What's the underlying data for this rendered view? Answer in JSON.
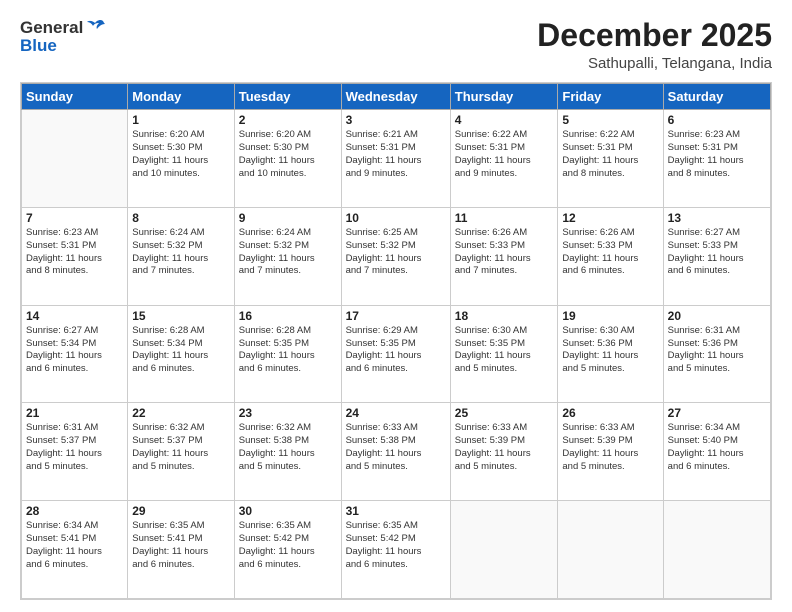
{
  "logo": {
    "general": "General",
    "blue": "Blue"
  },
  "title": "December 2025",
  "location": "Sathupalli, Telangana, India",
  "weekdays": [
    "Sunday",
    "Monday",
    "Tuesday",
    "Wednesday",
    "Thursday",
    "Friday",
    "Saturday"
  ],
  "weeks": [
    [
      {
        "day": "",
        "info": ""
      },
      {
        "day": "1",
        "info": "Sunrise: 6:20 AM\nSunset: 5:30 PM\nDaylight: 11 hours\nand 10 minutes."
      },
      {
        "day": "2",
        "info": "Sunrise: 6:20 AM\nSunset: 5:30 PM\nDaylight: 11 hours\nand 10 minutes."
      },
      {
        "day": "3",
        "info": "Sunrise: 6:21 AM\nSunset: 5:31 PM\nDaylight: 11 hours\nand 9 minutes."
      },
      {
        "day": "4",
        "info": "Sunrise: 6:22 AM\nSunset: 5:31 PM\nDaylight: 11 hours\nand 9 minutes."
      },
      {
        "day": "5",
        "info": "Sunrise: 6:22 AM\nSunset: 5:31 PM\nDaylight: 11 hours\nand 8 minutes."
      },
      {
        "day": "6",
        "info": "Sunrise: 6:23 AM\nSunset: 5:31 PM\nDaylight: 11 hours\nand 8 minutes."
      }
    ],
    [
      {
        "day": "7",
        "info": "Sunrise: 6:23 AM\nSunset: 5:31 PM\nDaylight: 11 hours\nand 8 minutes."
      },
      {
        "day": "8",
        "info": "Sunrise: 6:24 AM\nSunset: 5:32 PM\nDaylight: 11 hours\nand 7 minutes."
      },
      {
        "day": "9",
        "info": "Sunrise: 6:24 AM\nSunset: 5:32 PM\nDaylight: 11 hours\nand 7 minutes."
      },
      {
        "day": "10",
        "info": "Sunrise: 6:25 AM\nSunset: 5:32 PM\nDaylight: 11 hours\nand 7 minutes."
      },
      {
        "day": "11",
        "info": "Sunrise: 6:26 AM\nSunset: 5:33 PM\nDaylight: 11 hours\nand 7 minutes."
      },
      {
        "day": "12",
        "info": "Sunrise: 6:26 AM\nSunset: 5:33 PM\nDaylight: 11 hours\nand 6 minutes."
      },
      {
        "day": "13",
        "info": "Sunrise: 6:27 AM\nSunset: 5:33 PM\nDaylight: 11 hours\nand 6 minutes."
      }
    ],
    [
      {
        "day": "14",
        "info": "Sunrise: 6:27 AM\nSunset: 5:34 PM\nDaylight: 11 hours\nand 6 minutes."
      },
      {
        "day": "15",
        "info": "Sunrise: 6:28 AM\nSunset: 5:34 PM\nDaylight: 11 hours\nand 6 minutes."
      },
      {
        "day": "16",
        "info": "Sunrise: 6:28 AM\nSunset: 5:35 PM\nDaylight: 11 hours\nand 6 minutes."
      },
      {
        "day": "17",
        "info": "Sunrise: 6:29 AM\nSunset: 5:35 PM\nDaylight: 11 hours\nand 6 minutes."
      },
      {
        "day": "18",
        "info": "Sunrise: 6:30 AM\nSunset: 5:35 PM\nDaylight: 11 hours\nand 5 minutes."
      },
      {
        "day": "19",
        "info": "Sunrise: 6:30 AM\nSunset: 5:36 PM\nDaylight: 11 hours\nand 5 minutes."
      },
      {
        "day": "20",
        "info": "Sunrise: 6:31 AM\nSunset: 5:36 PM\nDaylight: 11 hours\nand 5 minutes."
      }
    ],
    [
      {
        "day": "21",
        "info": "Sunrise: 6:31 AM\nSunset: 5:37 PM\nDaylight: 11 hours\nand 5 minutes."
      },
      {
        "day": "22",
        "info": "Sunrise: 6:32 AM\nSunset: 5:37 PM\nDaylight: 11 hours\nand 5 minutes."
      },
      {
        "day": "23",
        "info": "Sunrise: 6:32 AM\nSunset: 5:38 PM\nDaylight: 11 hours\nand 5 minutes."
      },
      {
        "day": "24",
        "info": "Sunrise: 6:33 AM\nSunset: 5:38 PM\nDaylight: 11 hours\nand 5 minutes."
      },
      {
        "day": "25",
        "info": "Sunrise: 6:33 AM\nSunset: 5:39 PM\nDaylight: 11 hours\nand 5 minutes."
      },
      {
        "day": "26",
        "info": "Sunrise: 6:33 AM\nSunset: 5:39 PM\nDaylight: 11 hours\nand 5 minutes."
      },
      {
        "day": "27",
        "info": "Sunrise: 6:34 AM\nSunset: 5:40 PM\nDaylight: 11 hours\nand 6 minutes."
      }
    ],
    [
      {
        "day": "28",
        "info": "Sunrise: 6:34 AM\nSunset: 5:41 PM\nDaylight: 11 hours\nand 6 minutes."
      },
      {
        "day": "29",
        "info": "Sunrise: 6:35 AM\nSunset: 5:41 PM\nDaylight: 11 hours\nand 6 minutes."
      },
      {
        "day": "30",
        "info": "Sunrise: 6:35 AM\nSunset: 5:42 PM\nDaylight: 11 hours\nand 6 minutes."
      },
      {
        "day": "31",
        "info": "Sunrise: 6:35 AM\nSunset: 5:42 PM\nDaylight: 11 hours\nand 6 minutes."
      },
      {
        "day": "",
        "info": ""
      },
      {
        "day": "",
        "info": ""
      },
      {
        "day": "",
        "info": ""
      }
    ]
  ]
}
